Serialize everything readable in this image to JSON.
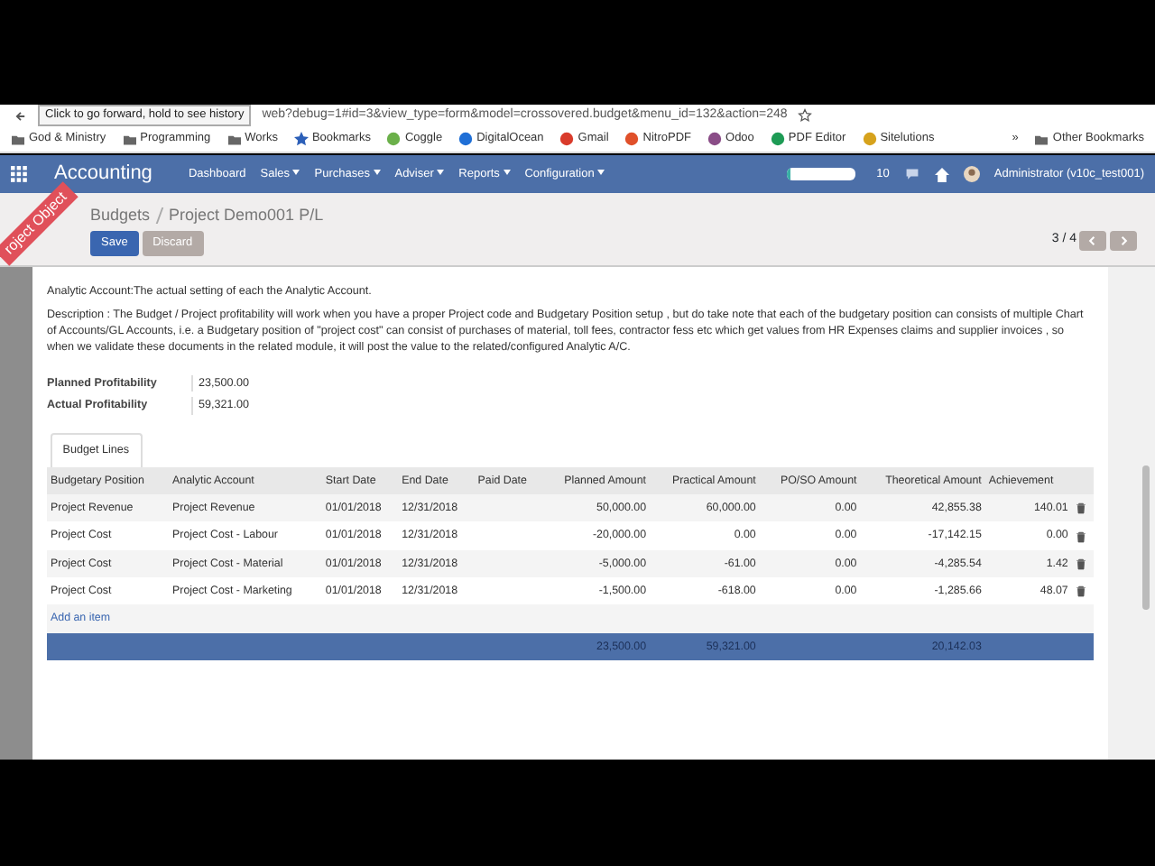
{
  "browser": {
    "tooltip": "Click to go forward, hold to see history",
    "url": "web?debug=1#id=3&view_type=form&model=crossovered.budget&menu_id=132&action=248",
    "bookmarks": [
      {
        "label": "God & Ministry",
        "kind": "folder"
      },
      {
        "label": "Programming",
        "kind": "folder"
      },
      {
        "label": "Works",
        "kind": "folder"
      },
      {
        "label": "Bookmarks",
        "kind": "star"
      },
      {
        "label": "Coggle",
        "kind": "site",
        "color": "#6bb04a"
      },
      {
        "label": "DigitalOcean",
        "kind": "site",
        "color": "#1f6fd6"
      },
      {
        "label": "Gmail",
        "kind": "site",
        "color": "#d93b2b"
      },
      {
        "label": "NitroPDF",
        "kind": "site",
        "color": "#e0502a"
      },
      {
        "label": "Odoo",
        "kind": "site",
        "color": "#8a4d87"
      },
      {
        "label": "PDF Editor",
        "kind": "site",
        "color": "#1e9b55"
      },
      {
        "label": "Sitelutions",
        "kind": "site",
        "color": "#d6a21c"
      }
    ],
    "overflow": "»",
    "other_bookmarks": "Other Bookmarks"
  },
  "navbar": {
    "app": "Accounting",
    "menus": [
      {
        "label": "Dashboard",
        "dropdown": false
      },
      {
        "label": "Sales",
        "dropdown": true
      },
      {
        "label": "Purchases",
        "dropdown": true
      },
      {
        "label": "Adviser",
        "dropdown": true
      },
      {
        "label": "Reports",
        "dropdown": true
      },
      {
        "label": "Configuration",
        "dropdown": true
      }
    ],
    "progress": {
      "level": 0.06
    },
    "notifications": "10",
    "user": "Administrator (v10c_test001)"
  },
  "ribbon": "roject Object",
  "breadcrumb": [
    "Budgets",
    "Project Demo001 P/L"
  ],
  "buttons": [
    {
      "label": "Save",
      "kind": "primary"
    },
    {
      "label": "Discard",
      "kind": "secondary"
    }
  ],
  "pager": "3 / 4",
  "notes": [
    "Analytic Account:The actual setting of each the Analytic Account.",
    "Description : The Budget / Project profitability will work when you have a proper Project code and Budgetary Position setup , but do take note that each of the budgetary position can consists of multiple Chart of Accounts/GL Accounts, i.e. a Budgetary position of \"project cost\" can consist of purchases of material, toll fees, contractor fess etc which get values from HR Expenses claims and supplier invoices , so when we validate these documents in the related module, it will post the value to the related/configured Analytic A/C."
  ],
  "fields": [
    {
      "label": "Planned Profitability",
      "value": "23,500.00"
    },
    {
      "label": "Actual Profitability",
      "value": "59,321.00"
    }
  ],
  "tabs": [
    {
      "label": "Budget Lines",
      "selected": true
    }
  ],
  "table": {
    "columns": [
      "Budgetary Position",
      "Analytic Account",
      "Start Date",
      "End Date",
      "Paid Date",
      "Planned Amount",
      "Practical Amount",
      "PO/SO Amount",
      "Theoretical Amount",
      "Achievement"
    ],
    "rows": [
      [
        "Project Revenue",
        "Project Revenue",
        "01/01/2018",
        "12/31/2018",
        "",
        "50,000.00",
        "60,000.00",
        "0.00",
        "42,855.38",
        "140.01"
      ],
      [
        "Project Cost",
        "Project Cost - Labour",
        "01/01/2018",
        "12/31/2018",
        "",
        "-20,000.00",
        "0.00",
        "0.00",
        "-17,142.15",
        "0.00"
      ],
      [
        "Project Cost",
        "Project Cost - Material",
        "01/01/2018",
        "12/31/2018",
        "",
        "-5,000.00",
        "-61.00",
        "0.00",
        "-4,285.54",
        "1.42"
      ],
      [
        "Project Cost",
        "Project Cost - Marketing",
        "01/01/2018",
        "12/31/2018",
        "",
        "-1,500.00",
        "-618.00",
        "0.00",
        "-1,285.66",
        "48.07"
      ]
    ],
    "add_item": "Add an item",
    "totals": {
      "planned_amount": "23,500.00",
      "practical_amount": "59,321.00",
      "theoretical_amount": "20,142.03"
    }
  }
}
